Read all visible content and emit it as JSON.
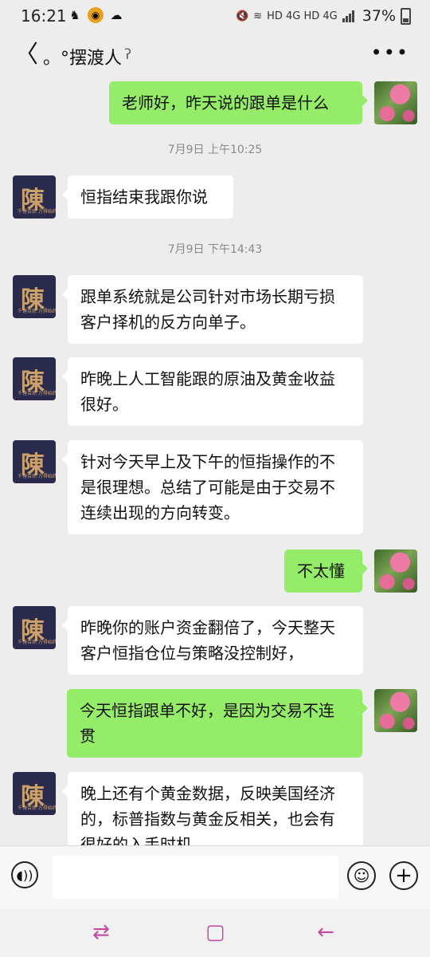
{
  "status_bar": {
    "time": "16:21",
    "network_label": "HD 4G HD 4G",
    "battery": "37%"
  },
  "header": {
    "back_icon": "chevron-left",
    "title": "。°摆渡人",
    "more_icon": "•••"
  },
  "messages": [
    {
      "type": "out",
      "avatar": "flower",
      "text": "老师好，昨天说的跟单是什么"
    },
    {
      "type": "time",
      "text": "7月9日 上午10:25"
    },
    {
      "type": "in",
      "avatar": "chen",
      "text": "恒指结束我跟你说"
    },
    {
      "type": "time",
      "text": "7月9日 下午14:43"
    },
    {
      "type": "in",
      "avatar": "chen",
      "text": "跟单系统就是公司针对市场长期亏损客户择机的反方向单子。"
    },
    {
      "type": "in",
      "avatar": "chen",
      "text": "昨晚上人工智能跟的原油及黄金收益很好。"
    },
    {
      "type": "in",
      "avatar": "chen",
      "text": "针对今天早上及下午的恒指操作的不是很理想。总结了可能是由于交易不连续出现的方向转变。"
    },
    {
      "type": "out",
      "avatar": "flower",
      "text": "不太懂"
    },
    {
      "type": "in",
      "avatar": "chen",
      "text": "昨晚你的账户资金翻倍了，今天整天客户恒指仓位与策略没控制好，"
    },
    {
      "type": "out",
      "avatar": "flower",
      "text": "今天恒指跟单不好，是因为交易不连贯"
    },
    {
      "type": "in",
      "avatar": "chen",
      "text": "晚上还有个黄金数据，反映美国经济的，标普指数与黄金反相关，也会有很好的入手时机"
    }
  ],
  "avatar_chen": {
    "char": "陳",
    "sub": "千锤百炼 方得始终"
  },
  "input_bar": {
    "value": ""
  },
  "colors": {
    "out_bubble": "#95ec69",
    "in_bubble": "#ffffff",
    "background": "#ededed",
    "nav_accent": "#c24aa0"
  }
}
